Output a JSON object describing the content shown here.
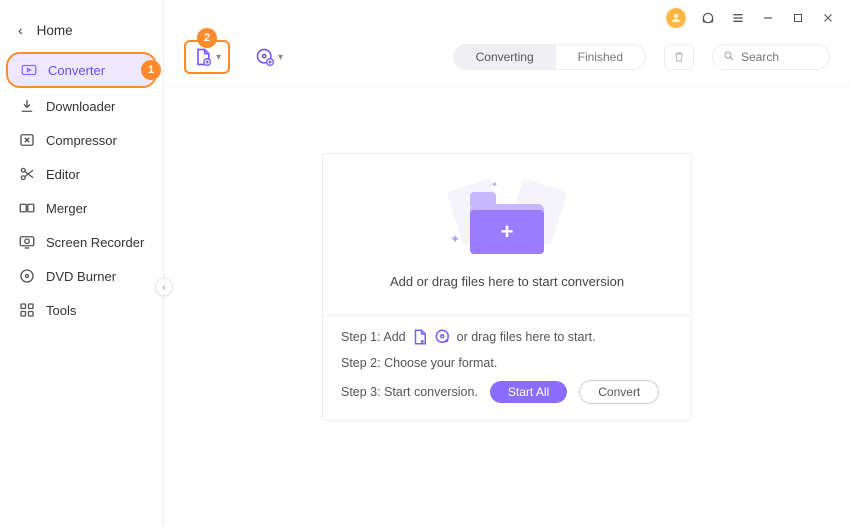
{
  "home_label": "Home",
  "sidebar": {
    "items": [
      {
        "label": "Converter"
      },
      {
        "label": "Downloader"
      },
      {
        "label": "Compressor"
      },
      {
        "label": "Editor"
      },
      {
        "label": "Merger"
      },
      {
        "label": "Screen Recorder"
      },
      {
        "label": "DVD Burner"
      },
      {
        "label": "Tools"
      }
    ]
  },
  "callouts": {
    "badge1": "1",
    "badge2": "2"
  },
  "tabs": {
    "converting": "Converting",
    "finished": "Finished"
  },
  "search": {
    "placeholder": "Search"
  },
  "drop": {
    "headline": "Add or drag files here to start conversion"
  },
  "steps": {
    "s1_prefix": "Step 1: Add",
    "s1_suffix": "or drag files here to start.",
    "s2": "Step 2: Choose your format.",
    "s3": "Step 3: Start conversion."
  },
  "buttons": {
    "start_all": "Start All",
    "convert": "Convert"
  }
}
